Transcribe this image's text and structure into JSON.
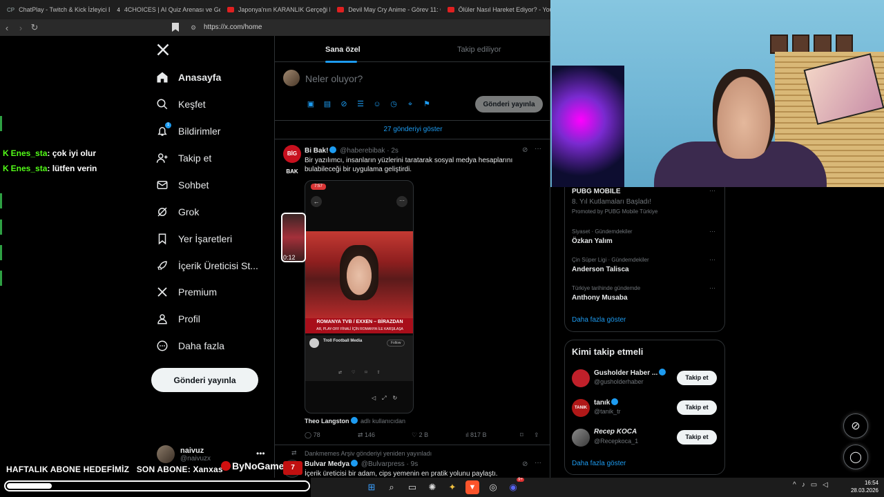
{
  "browser": {
    "tabs": [
      {
        "icon": "CP",
        "title": "ChatPlay - Twitch & Kick İzleyici Etki..."
      },
      {
        "icon": "4",
        "title": "4CHOICES | AI Quiz Arenası ve Gerçe..."
      },
      {
        "icon": "youtube-icon",
        "title": "Japonya'nın KARANLIK Gerçeği Ned..."
      },
      {
        "icon": "youtube-icon",
        "title": "Devil May Cry Anime - Görev 11: Gö..."
      },
      {
        "icon": "youtube-icon",
        "title": "Ölüler Nasıl Hareket Ediyor? - You..."
      }
    ],
    "url": "https://x.com/home"
  },
  "chat": [
    {
      "user": "Enes_sta",
      "message": ": çok iyi olur"
    },
    {
      "user": "Enes_sta",
      "message": ": lütfen verin"
    }
  ],
  "nav": {
    "items": [
      {
        "label": "Anasayfa",
        "icon": "home-icon"
      },
      {
        "label": "Keşfet",
        "icon": "search-icon"
      },
      {
        "label": "Bildirimler",
        "icon": "bell-icon",
        "badge": "1"
      },
      {
        "label": "Takip et",
        "icon": "follow-icon"
      },
      {
        "label": "Sohbet",
        "icon": "mail-icon"
      },
      {
        "label": "Grok",
        "icon": "grok-icon"
      },
      {
        "label": "Yer İşaretleri",
        "icon": "bookmark-icon"
      },
      {
        "label": "İçerik Üreticisi St...",
        "icon": "rocket-icon"
      },
      {
        "label": "Premium",
        "icon": "x-icon"
      },
      {
        "label": "Profil",
        "icon": "person-icon"
      },
      {
        "label": "Daha fazla",
        "icon": "more-circle-icon"
      }
    ],
    "post_button": "Gönderi yayınla",
    "profile": {
      "name": "naivuz",
      "handle": "@naivuzx"
    }
  },
  "feed": {
    "tabs": [
      "Sana özel",
      "Takip ediliyor"
    ],
    "compose_placeholder": "Neler oluyor?",
    "compose_post": "Gönderi yayınla",
    "show_more": "27 gönderiyi göster",
    "tweet1": {
      "avatar_text": "BİG BAK",
      "name": "Bi Bak!",
      "handle": "@haberebibak",
      "time": "· 2s",
      "text": "Bir yazılımcı, insanların yüzlerini taratarak sosyal medya hesaplarını bulabileceği bir uygulama geliştirdi.",
      "media": {
        "status_time": "7:57",
        "caption_line1": "ROMANYA   TVB / EXXEN – BİRAZDAN",
        "caption_line2": "AR, PLAY-OFF FİNALİ İÇİN ROMANYA İLE KARŞILAŞA",
        "card_name": "Troll Football Media",
        "card_follow": "Follow",
        "video_time": "0:12"
      },
      "attribution_name": "Theo Langston",
      "attribution_suffix": "adlı kullanıcıdan",
      "replies": "78",
      "reposts": "146",
      "likes": "2 B",
      "views": "817 B"
    },
    "tweet2": {
      "repost_note": "Dankmemes Arşiv gönderiyi yeniden yayınladı",
      "name": "Bulvar Medya",
      "handle": "@Bulvarpress",
      "time": "· 9s",
      "text": "İçerik üreticisi bir adam, cips yemenin en pratik yolunu paylaştı."
    }
  },
  "trends": {
    "items": [
      {
        "title": "PUBG MOBILE",
        "sub": "8. Yıl Kutlamaları Başladı!",
        "promoted": "Promoted by PUBG Mobile Türkiye"
      },
      {
        "category": "Siyaset · Gündemdekiler",
        "title": "Özkan Yalım"
      },
      {
        "category": "Çin Süper Ligi · Gündemdekiler",
        "title": "Anderson Talisca"
      },
      {
        "category": "Türkiye tarihinde gündemde",
        "title": "Anthony Musaba"
      }
    ],
    "show_more": "Daha fazla göster"
  },
  "who_to_follow": {
    "title": "Kimi takip etmeli",
    "users": [
      {
        "name": "Gusholder Haber ...",
        "handle": "@gusholderhaber",
        "button": "Takip et",
        "avatar_color": "#c0202a"
      },
      {
        "name": "tanık",
        "handle": "@tanik_tr",
        "button": "Takip et",
        "avatar_color": "#b01818",
        "avatar_text": "TANIK"
      },
      {
        "name": "Recep KOCA",
        "handle": "@Recepkoca_1",
        "button": "Takip et",
        "avatar_color": "#6a6a6a"
      }
    ],
    "show_more": "Daha fazla göster"
  },
  "overlay": {
    "goal_text": "HAFTALIK ABONE HEDEFİMİZ   SON ABONE: Xanxas",
    "logo": "ByNoGame",
    "badge": "7",
    "progress": 0.15
  },
  "taskbar": {
    "time": "16:54",
    "date": "28.03.2026",
    "discord_badge": "9+"
  },
  "colors": {
    "accent": "#1d9bf0",
    "kick_green": "#53fc18",
    "background": "#000000"
  }
}
